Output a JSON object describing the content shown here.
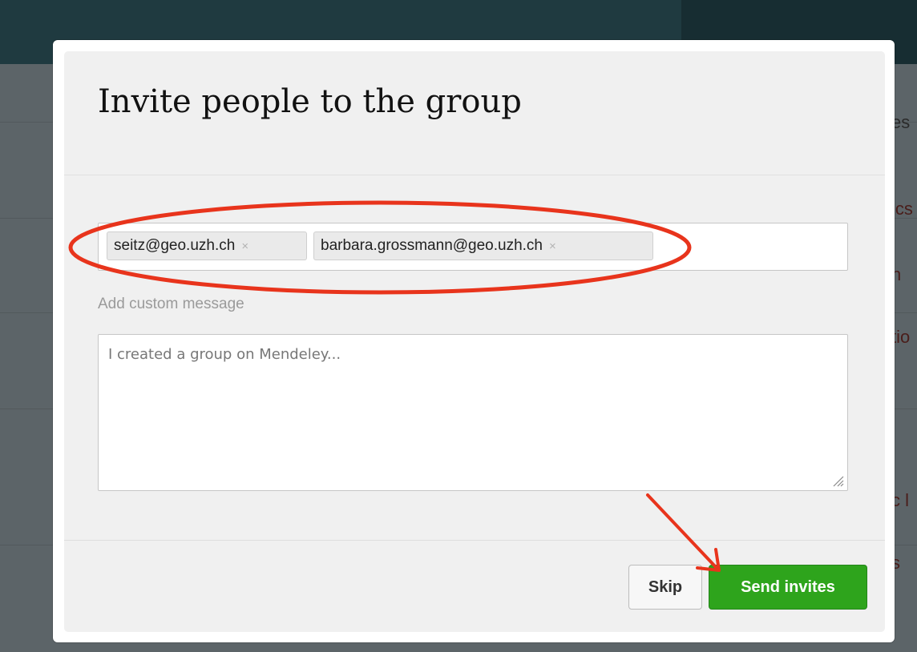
{
  "background_page": {
    "fragments": [
      "es",
      "ics",
      "n",
      "tio",
      "c l",
      "s"
    ]
  },
  "dialog": {
    "title": "Invite people to the group",
    "recipients": [
      {
        "email": "seitz@geo.uzh.ch",
        "remove_glyph": "×"
      },
      {
        "email": "barbara.grossmann@geo.uzh.ch",
        "remove_glyph": "×"
      }
    ],
    "custom_message_label": "Add custom message",
    "message_placeholder": "I created a group on Mendeley...",
    "buttons": {
      "skip": "Skip",
      "send": "Send invites"
    }
  },
  "annotations": {
    "ellipse_icon": "highlight-ellipse",
    "arrow_icon": "pointer-arrow",
    "annotation_color": "#e8341c"
  },
  "colors": {
    "send_button": "#2ea41c",
    "header_background": "#f0f0f0"
  }
}
